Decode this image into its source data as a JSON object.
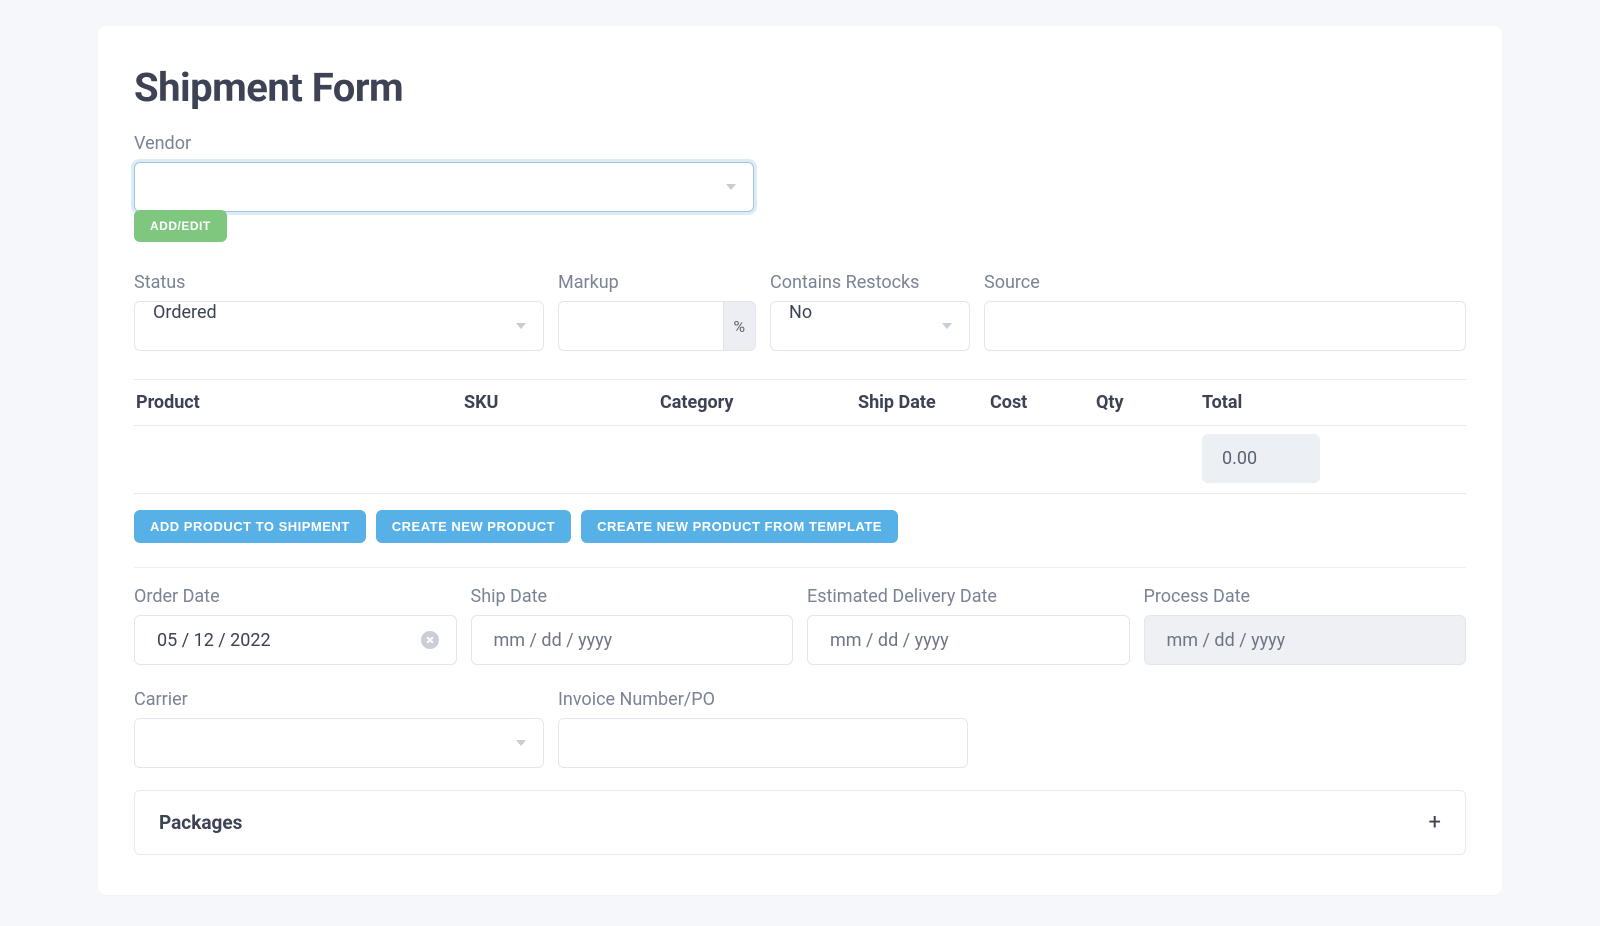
{
  "title": "Shipment Form",
  "vendor": {
    "label": "Vendor",
    "value": "",
    "add_edit_label": "ADD/EDIT"
  },
  "row2": {
    "status": {
      "label": "Status",
      "value": "Ordered"
    },
    "markup": {
      "label": "Markup",
      "value": "",
      "suffix": "%"
    },
    "restocks": {
      "label": "Contains Restocks",
      "value": "No"
    },
    "source": {
      "label": "Source",
      "value": ""
    }
  },
  "table": {
    "headers": {
      "product": "Product",
      "sku": "SKU",
      "category": "Category",
      "ship_date": "Ship Date",
      "cost": "Cost",
      "qty": "Qty",
      "total": "Total"
    },
    "total_value": "0.00"
  },
  "actions": {
    "add_product": "ADD PRODUCT TO SHIPMENT",
    "create_product": "CREATE NEW PRODUCT",
    "create_from_template": "CREATE NEW PRODUCT FROM TEMPLATE"
  },
  "dates": {
    "order": {
      "label": "Order Date",
      "value": "05 / 12 / 2022"
    },
    "ship": {
      "label": "Ship Date",
      "placeholder": "mm / dd / yyyy"
    },
    "edd": {
      "label": "Estimated Delivery Date",
      "placeholder": "mm / dd / yyyy"
    },
    "process": {
      "label": "Process Date",
      "placeholder": "mm / dd / yyyy"
    }
  },
  "carrier": {
    "label": "Carrier",
    "value": ""
  },
  "invoice": {
    "label": "Invoice Number/PO",
    "value": ""
  },
  "packages": {
    "label": "Packages"
  }
}
